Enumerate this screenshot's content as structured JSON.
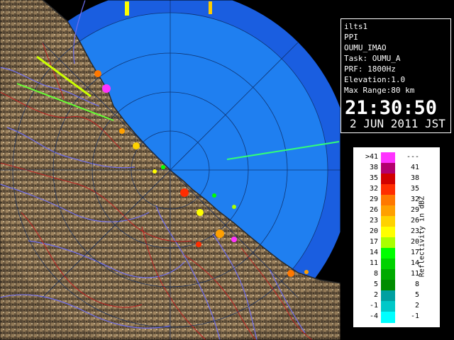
{
  "header": {
    "system": "ilts1",
    "scan_type": "PPI",
    "product": "OUMU_IMAO",
    "task": "Task: OUMU_A",
    "prf": "PRF: 1800Hz",
    "elevation": "Elevation:1.0",
    "max_range": "Max Range:80 km",
    "time": "21:30:50",
    "date": "2 JUN 2011 JST"
  },
  "legend": {
    "unit": "Reflectivity in dBZ",
    "bins": [
      {
        "low": ">41",
        "high": "---",
        "color": "#ff33ff"
      },
      {
        "low": "38",
        "high": "41",
        "color": "#b4006e"
      },
      {
        "low": "35",
        "high": "38",
        "color": "#d20000"
      },
      {
        "low": "32",
        "high": "35",
        "color": "#ff2d00"
      },
      {
        "low": "29",
        "high": "32",
        "color": "#ff7800"
      },
      {
        "low": "26",
        "high": "29",
        "color": "#ffa000"
      },
      {
        "low": "23",
        "high": "26",
        "color": "#ffd200"
      },
      {
        "low": "20",
        "high": "23",
        "color": "#ffff00"
      },
      {
        "low": "17",
        "high": "20",
        "color": "#aaff00"
      },
      {
        "low": "14",
        "high": "17",
        "color": "#00ff00"
      },
      {
        "low": "11",
        "high": "14",
        "color": "#00d200"
      },
      {
        "low": "8",
        "high": "11",
        "color": "#00aa00"
      },
      {
        "low": "5",
        "high": "8",
        "color": "#008c00"
      },
      {
        "low": "2",
        "high": "5",
        "color": "#00a0a0"
      },
      {
        "low": "-1",
        "high": "2",
        "color": "#00c8c8"
      },
      {
        "low": "-4",
        "high": "-1",
        "color": "#00ffff"
      }
    ]
  },
  "map": {
    "sea_color": "#1f7ff0",
    "outer_ring_color": "#1a5ee0",
    "land_color": "#7d6a4e",
    "river_color": "#6f6ff0",
    "boundary_color": "#c02020"
  }
}
